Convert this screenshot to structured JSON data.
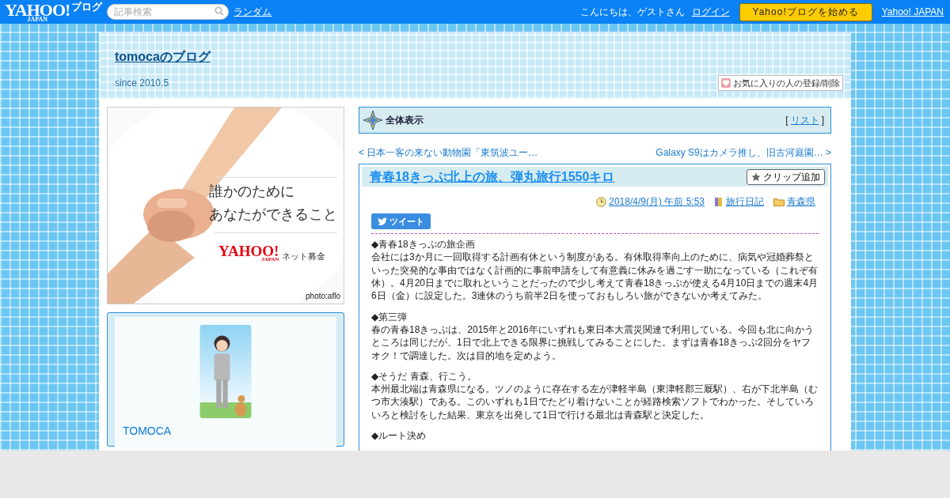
{
  "topbar": {
    "logo": "YAHOO!",
    "logo_sub": "JAPAN",
    "logo_service": "ブログ",
    "search": {
      "placeholder": "記事検索"
    },
    "random_link": "ランダム",
    "greeting": "こんにちは、ゲストさん",
    "login_link": "ログイン",
    "start_button": "Yahoo!ブログを始める",
    "yahoo_link": "Yahoo! JAPAN"
  },
  "blog_header": {
    "title": "tomocaのブログ",
    "subtitle": "since 2010.5",
    "favorite_button": "お気に入りの人の登録/削除"
  },
  "ad": {
    "kind": "picture",
    "headline": [
      "誰かのために",
      "あなたができること"
    ],
    "brand": "YAHOO!",
    "brand_sub": "JAPAN",
    "service": "ネット募金",
    "credit": "photo:aflo"
  },
  "profile": {
    "name": "TOMOCA"
  },
  "view_bar": {
    "label": "全体表示",
    "list_open": "[",
    "list_link": "リスト",
    "list_close": "]"
  },
  "article_nav": {
    "prev_mark": "<",
    "prev": "日本一客の来ない動物園「東筑波ユー…",
    "next": "Galaxy S9はカメラ推し、旧古河庭園…",
    "next_mark": ">"
  },
  "article": {
    "title": "青春18きっぷ北上の旅、弾丸旅行1550キロ",
    "clip_button": "クリップ追加",
    "date": "2018/4/9(月) 午前 5:53",
    "category": "旅行日記",
    "folder": "青森県",
    "tweet_button": "ツイート",
    "sections": [
      {
        "heading": "◆青春18きっぷの旅企画",
        "body": "会社には3か月に一回取得する計画有休という制度がある。有休取得率向上のために、病気や冠婚葬祭といった突発的な事由ではなく計画的に事前申請をして有意義に休みを過ごす一助になっている（これぞ有休）。4月20日までに取れということだったので少し考えて青春18きっぷが使える4月10日までの週末4月6日（金）に設定した。3連休のうち前半2日を使っておもしろい旅ができないか考えてみた。"
      },
      {
        "heading": "◆第三弾",
        "body": "春の青春18きっぷは、2015年と2016年にいずれも東日本大震災関連で利用している。今回も北に向かうところは同じだが、1日で北上できる限界に挑戦してみることにした。まずは青春18きっぷ2回分をヤフオク！で調達した。次は目的地を定めよう。"
      },
      {
        "heading": "◆そうだ 青森、行こう。",
        "body": "本州最北端は青森県になる。ツノのように存在する左が津軽半島（東津軽郡三厩駅）、右が下北半島（むつ市大湊駅）である。このいずれも1日でたどり着けないことが経路検索ソフトでわかった。そしていろいろと検討をした結果、東京を出発して1日で行ける最北は青森駅と決定した。"
      },
      {
        "heading": "◆ルート決め"
      }
    ]
  }
}
